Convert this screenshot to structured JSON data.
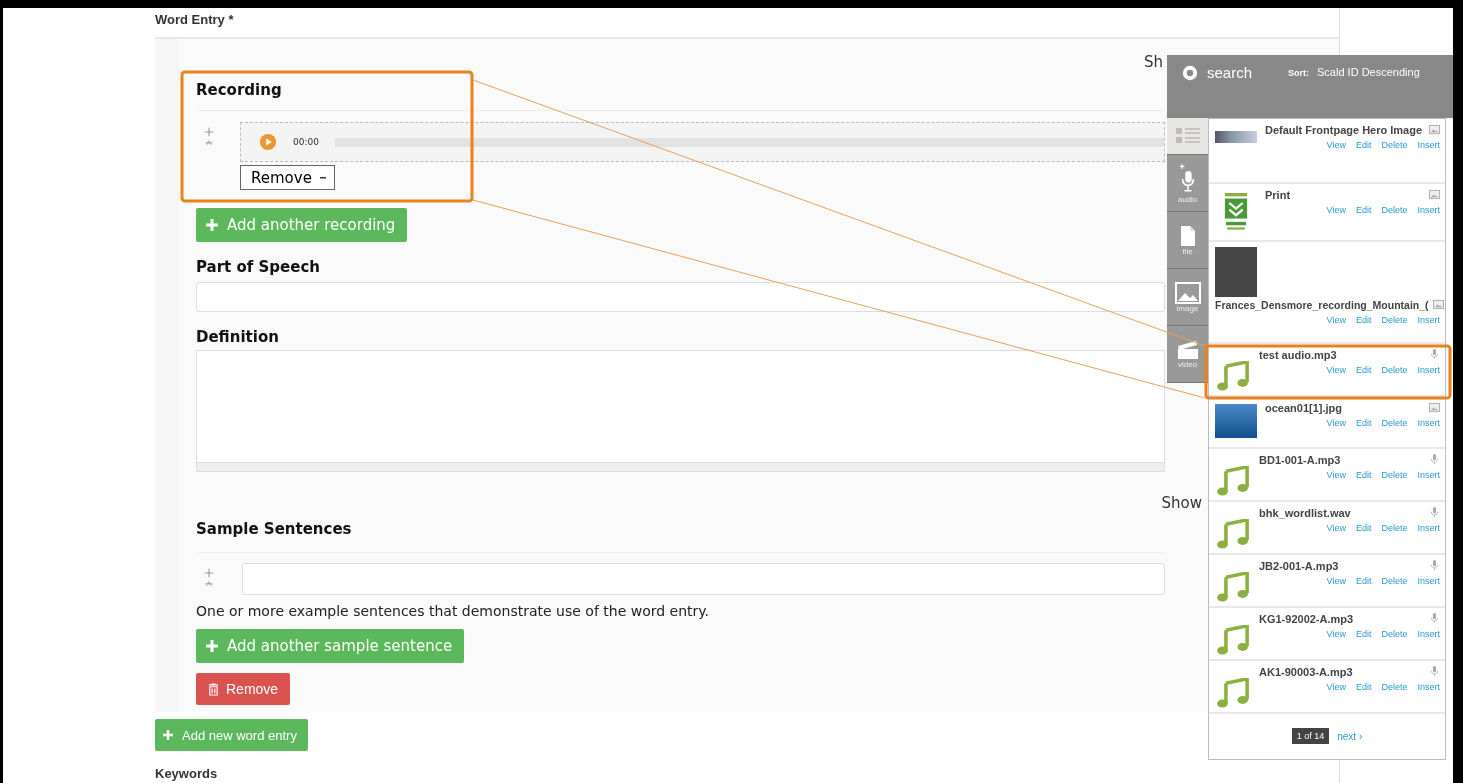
{
  "section_label": "Word Entry *",
  "recording": {
    "row_weights_toggle": "Sh",
    "heading": "Recording",
    "time": "00:00",
    "remove_select": "Remove",
    "add_button": "Add another recording"
  },
  "part_of_speech": {
    "label": "Part of Speech"
  },
  "definition": {
    "label": "Definition"
  },
  "sample_sentences": {
    "row_weights_toggle": "Show",
    "heading": "Sample Sentences",
    "description": "One or more example sentences that demonstrate use of the word entry.",
    "add_button": "Add another sample sentence"
  },
  "remove_button": "Remove",
  "add_entry_button": "Add new word entry",
  "next_label": "Keywords",
  "library": {
    "search_label": "search",
    "sort_label": "Sort:",
    "sort_value": "Scald ID Descending",
    "rail": [
      {
        "kind": "list",
        "selected": true
      },
      {
        "kind": "audio",
        "label": "audio",
        "selected": false
      },
      {
        "kind": "file",
        "label": "file",
        "selected": false
      },
      {
        "kind": "image",
        "label": "image",
        "selected": false
      },
      {
        "kind": "video",
        "label": "video",
        "selected": false
      }
    ],
    "items": [
      {
        "title": "Default Frontpage Hero Image",
        "kind": "landscape",
        "actions": [
          "View",
          "Edit",
          "Delete",
          "Insert"
        ]
      },
      {
        "title": "Print",
        "kind": "logo",
        "actions": [
          "View",
          "Edit",
          "Delete",
          "Insert"
        ]
      },
      {
        "title": "Frances_Densmore_recording_Mountain_(",
        "kind": "photo",
        "actions": [
          "View",
          "Edit",
          "Delete",
          "Insert"
        ]
      },
      {
        "title": "test audio.mp3",
        "kind": "audio",
        "actions": [
          "View",
          "Edit",
          "Delete",
          "Insert"
        ]
      },
      {
        "title": "ocean01[1].jpg",
        "kind": "ocean",
        "actions": [
          "View",
          "Edit",
          "Delete",
          "Insert"
        ]
      },
      {
        "title": "BD1-001-A.mp3",
        "kind": "audio",
        "actions": [
          "View",
          "Edit",
          "Delete",
          "Insert"
        ]
      },
      {
        "title": "bhk_wordlist.wav",
        "kind": "audio",
        "actions": [
          "View",
          "Edit",
          "Delete",
          "Insert"
        ]
      },
      {
        "title": "JB2-001-A.mp3",
        "kind": "audio",
        "actions": [
          "View",
          "Edit",
          "Delete",
          "Insert"
        ]
      },
      {
        "title": "KG1-92002-A.mp3",
        "kind": "audio",
        "actions": [
          "View",
          "Edit",
          "Delete",
          "Insert"
        ]
      },
      {
        "title": "AK1-90003-A.mp3",
        "kind": "audio",
        "actions": [
          "View",
          "Edit",
          "Delete",
          "Insert"
        ]
      }
    ],
    "pager": {
      "page": "1 of 14",
      "next": "next ›"
    }
  }
}
